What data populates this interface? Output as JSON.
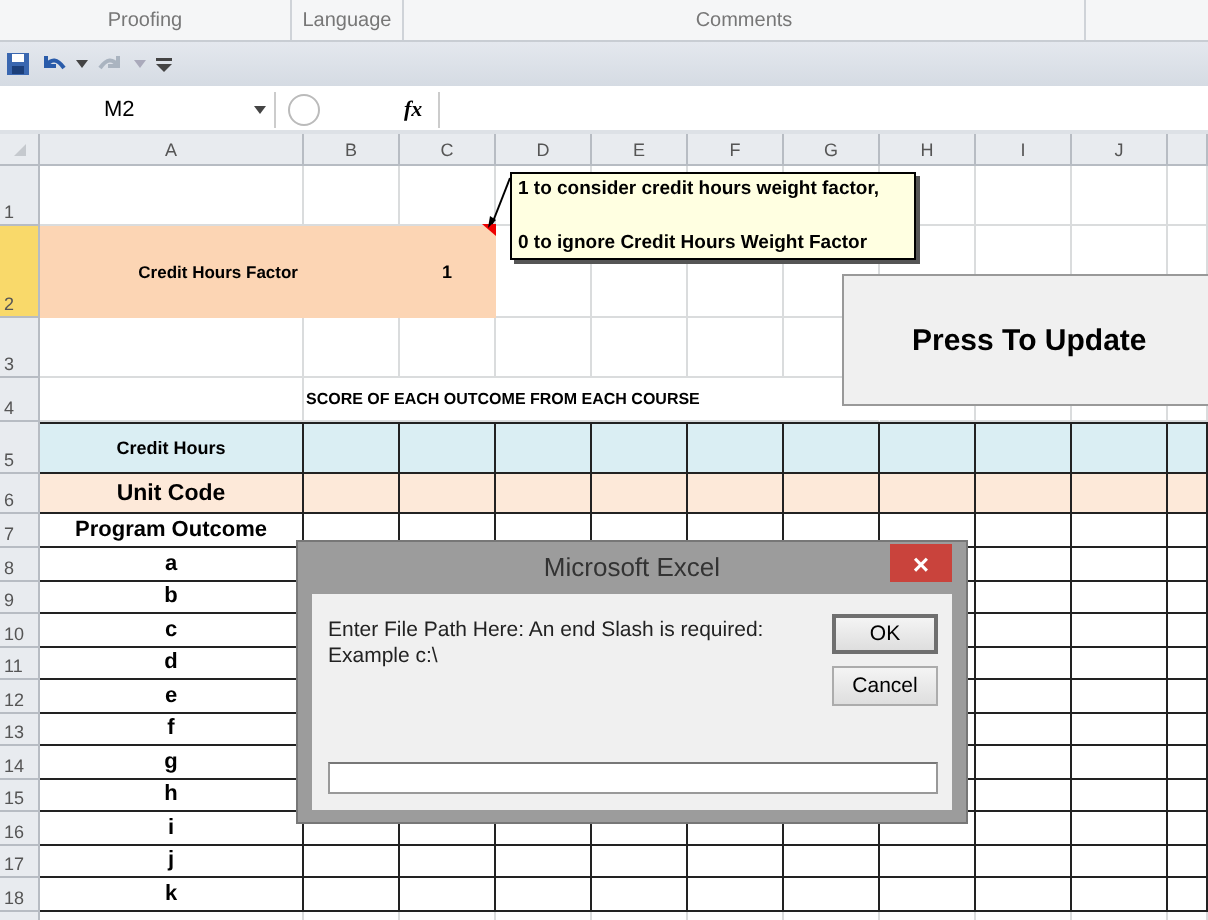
{
  "ribbon_groups": [
    {
      "label": "Proofing"
    },
    {
      "label": "Language"
    },
    {
      "label": "Comments"
    }
  ],
  "name_box": "M2",
  "function_button": "fx",
  "columns": [
    "A",
    "B",
    "C",
    "D",
    "E",
    "F",
    "G",
    "H",
    "I",
    "J"
  ],
  "row_headers": [
    {
      "label": "1",
      "selected": false
    },
    {
      "label": "2",
      "selected": true
    },
    {
      "label": "3",
      "selected": false
    },
    {
      "label": "4",
      "selected": false
    },
    {
      "label": "5",
      "selected": false
    },
    {
      "label": "6",
      "selected": false
    },
    {
      "label": "7",
      "selected": false
    },
    {
      "label": "8",
      "selected": false
    },
    {
      "label": "9",
      "selected": false
    },
    {
      "label": "10",
      "selected": false
    },
    {
      "label": "11",
      "selected": false
    },
    {
      "label": "12",
      "selected": false
    },
    {
      "label": "13",
      "selected": false
    },
    {
      "label": "14",
      "selected": false
    },
    {
      "label": "15",
      "selected": false
    },
    {
      "label": "16",
      "selected": false
    },
    {
      "label": "17",
      "selected": false
    },
    {
      "label": "18",
      "selected": false
    }
  ],
  "credit_hours_factor": {
    "label": "Credit Hours Factor",
    "value": "1"
  },
  "heading": "SCORE OF EACH OUTCOME FROM EACH COURSE",
  "row_labels": [
    {
      "text": "Credit Hours",
      "kind": "credit"
    },
    {
      "text": "Unit Code",
      "kind": "unit"
    },
    {
      "text": "Program Outcome",
      "kind": "plain"
    }
  ],
  "outcomes": [
    "a",
    "b",
    "c",
    "d",
    "e",
    "f",
    "g",
    "h",
    "i",
    "j",
    "k"
  ],
  "comment": [
    "1 to consider credit hours weight factor,",
    "0 to ignore Credit Hours Weight Factor"
  ],
  "update_button": "Press To Update",
  "dialog": {
    "title": "Microsoft Excel",
    "close": "×",
    "message": [
      "Enter File Path Here: An end Slash is required:",
      "Example c:\\"
    ],
    "buttons": [
      {
        "label": "OK",
        "default": true
      },
      {
        "label": "Cancel",
        "default": false
      }
    ]
  }
}
